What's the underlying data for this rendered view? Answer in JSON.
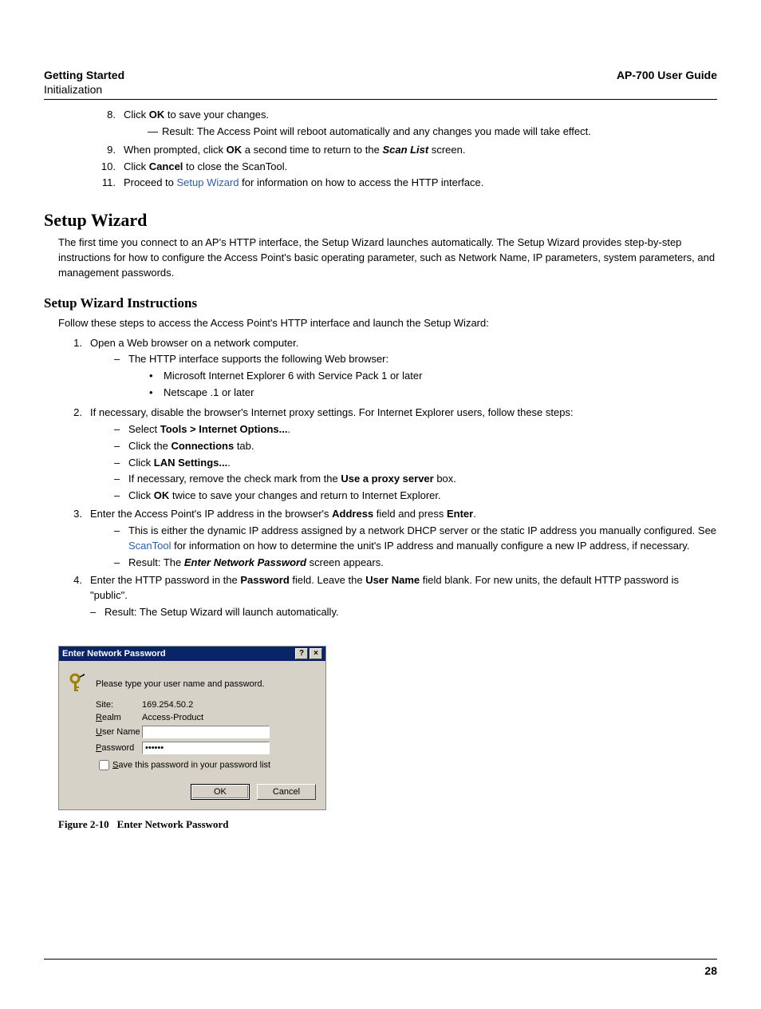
{
  "header": {
    "left_title": "Getting Started",
    "left_sub": "Initialization",
    "right": "AP-700 User Guide"
  },
  "top_steps": {
    "s8": {
      "num": "8.",
      "pre": "Click ",
      "b": "OK",
      "post": " to save your changes."
    },
    "s8_sub": "Result: The Access Point will reboot automatically and any changes you made will take effect.",
    "s9": {
      "num": "9.",
      "pre": "When prompted, click ",
      "b1": "OK",
      "mid": " a second time to return to the ",
      "bi": "Scan List",
      "post": " screen."
    },
    "s10": {
      "num": "10.",
      "pre": "Click ",
      "b": "Cancel",
      "post": " to close the ScanTool."
    },
    "s11": {
      "num": "11.",
      "pre": "Proceed to ",
      "link": "Setup Wizard",
      "post": " for information on how to access the HTTP interface."
    }
  },
  "h1": "Setup Wizard",
  "intro": "The first time you connect to an AP's HTTP interface, the Setup Wizard launches automatically. The Setup Wizard provides step-by-step instructions for how to configure the Access Point's basic operating parameter, such as Network Name, IP parameters, system parameters, and management passwords.",
  "h2": "Setup Wizard Instructions",
  "instr_intro": "Follow these steps to access the Access Point's HTTP interface and launch the Setup Wizard:",
  "steps": {
    "s1": {
      "num": "1.",
      "txt": "Open a Web browser on a network computer."
    },
    "s1a": "The HTTP interface supports the following Web browser:",
    "s1a_b1": "Microsoft Internet Explorer 6 with Service Pack 1 or later",
    "s1a_b2": "Netscape   .1 or later",
    "s2": {
      "num": "2.",
      "txt": "If necessary, disable the browser's Internet proxy settings. For Internet Explorer users, follow these steps:"
    },
    "s2a": {
      "pre": "Select ",
      "b": "Tools > Internet Options...",
      "post": "."
    },
    "s2b": {
      "pre": "Click the ",
      "b": "Connections",
      "post": " tab."
    },
    "s2c": {
      "pre": "Click ",
      "b": "LAN Settings...",
      "post": "."
    },
    "s2d": {
      "pre": "If necessary, remove the check mark from the ",
      "b": "Use a proxy server",
      "post": " box."
    },
    "s2e": {
      "pre": "Click ",
      "b": "OK",
      "post": " twice to save your changes and return to Internet Explorer."
    },
    "s3": {
      "num": "3.",
      "pre": "Enter the Access Point's IP address in the browser's ",
      "b1": "Address",
      "mid": " field and press ",
      "b2": "Enter",
      "post": "."
    },
    "s3a": {
      "pre": "This is either the dynamic IP address assigned by a network DHCP server or the static IP address you manually configured. See ",
      "link": "ScanTool",
      "post": " for information on how to determine the unit's IP address and manually configure a new IP address, if necessary."
    },
    "s3b": {
      "pre": "Result: The ",
      "bi": "Enter Network Password",
      "post": " screen appears."
    },
    "s4": {
      "num": "4.",
      "pre": "Enter the HTTP password in the ",
      "b1": "Password",
      "mid1": " field. Leave the ",
      "b2": "User Name",
      "mid2": " field blank. For new units, the default HTTP password is \"public\"."
    },
    "s4a": "Result: The Setup Wizard will launch automatically."
  },
  "dialog": {
    "title": "Enter Network Password",
    "prompt": "Please type your user name and password.",
    "site_label": "Site:",
    "site_val": "169.254.50.2",
    "realm_label": "Realm",
    "realm_val": "Access-Product",
    "user_label": "User Name",
    "user_val": "",
    "pwd_label": "Password",
    "pwd_val": "••••••",
    "save_label": "Save this password in your password list",
    "ok": "OK",
    "cancel": "Cancel"
  },
  "figure": {
    "num": "Figure 2-10",
    "title": "Enter Network Password"
  },
  "page_number": "28"
}
